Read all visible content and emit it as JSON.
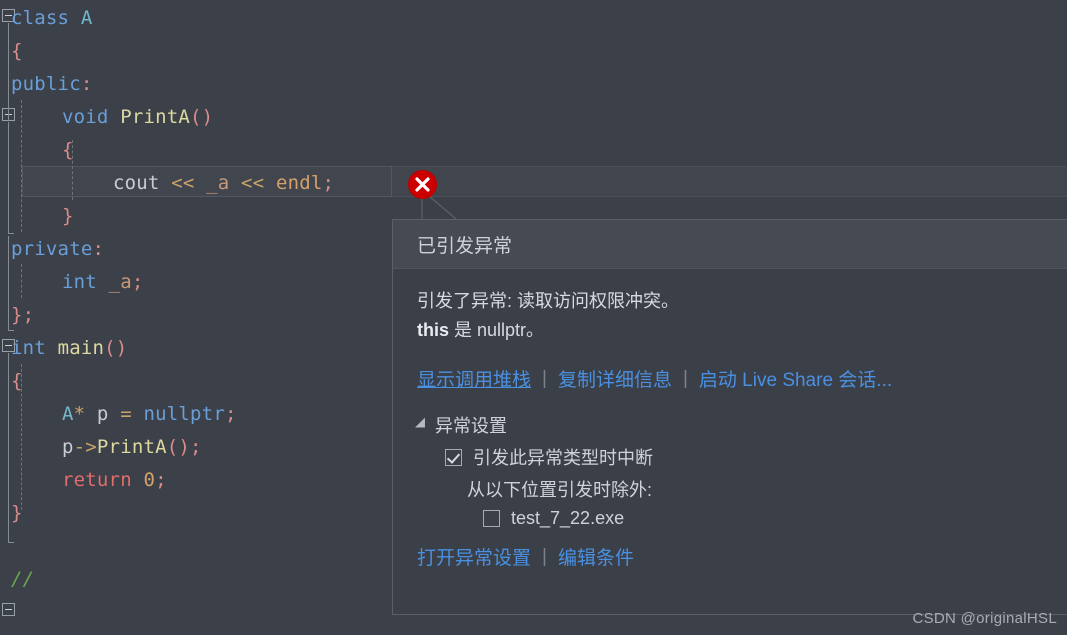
{
  "editor": {
    "language": "cpp",
    "background": "#3c4049",
    "lines": [
      {
        "indent": 0,
        "tokens": [
          {
            "t": "class",
            "c": "t-key"
          },
          {
            "t": " ",
            "c": "t-plain"
          },
          {
            "t": "A",
            "c": "t-type"
          }
        ]
      },
      {
        "indent": 0,
        "tokens": [
          {
            "t": "{",
            "c": "t-brace"
          }
        ]
      },
      {
        "indent": 0,
        "tokens": [
          {
            "t": "public",
            "c": "t-key"
          },
          {
            "t": ":",
            "c": "t-brace"
          }
        ]
      },
      {
        "indent": 1,
        "tokens": [
          {
            "t": "void",
            "c": "t-key"
          },
          {
            "t": " ",
            "c": "t-plain"
          },
          {
            "t": "PrintA",
            "c": "t-fn"
          },
          {
            "t": "()",
            "c": "t-brace"
          }
        ]
      },
      {
        "indent": 1,
        "tokens": [
          {
            "t": "{",
            "c": "t-brace"
          }
        ]
      },
      {
        "indent": 2,
        "tokens": [
          {
            "t": "cout",
            "c": "t-plain"
          },
          {
            "t": " ",
            "c": "t-plain"
          },
          {
            "t": "<<",
            "c": "t-op"
          },
          {
            "t": " ",
            "c": "t-plain"
          },
          {
            "t": "_a",
            "c": "t-var"
          },
          {
            "t": " ",
            "c": "t-plain"
          },
          {
            "t": "<<",
            "c": "t-op"
          },
          {
            "t": " ",
            "c": "t-plain"
          },
          {
            "t": "endl",
            "c": "t-mac"
          },
          {
            "t": ";",
            "c": "t-brace"
          }
        ]
      },
      {
        "indent": 1,
        "tokens": [
          {
            "t": "}",
            "c": "t-brace"
          }
        ]
      },
      {
        "indent": 0,
        "tokens": [
          {
            "t": "private",
            "c": "t-key"
          },
          {
            "t": ":",
            "c": "t-brace"
          }
        ]
      },
      {
        "indent": 1,
        "tokens": [
          {
            "t": "int",
            "c": "t-key"
          },
          {
            "t": " ",
            "c": "t-plain"
          },
          {
            "t": "_a",
            "c": "t-var"
          },
          {
            "t": ";",
            "c": "t-brace"
          }
        ]
      },
      {
        "indent": 0,
        "tokens": [
          {
            "t": "};",
            "c": "t-brace"
          }
        ]
      },
      {
        "indent": 0,
        "tokens": [
          {
            "t": "int",
            "c": "t-key"
          },
          {
            "t": " ",
            "c": "t-plain"
          },
          {
            "t": "main",
            "c": "t-fn"
          },
          {
            "t": "()",
            "c": "t-brace"
          }
        ]
      },
      {
        "indent": 0,
        "tokens": [
          {
            "t": "{",
            "c": "t-brace"
          }
        ]
      },
      {
        "indent": 1,
        "tokens": [
          {
            "t": "A",
            "c": "t-type"
          },
          {
            "t": "*",
            "c": "t-op"
          },
          {
            "t": " ",
            "c": "t-plain"
          },
          {
            "t": "p",
            "c": "t-plain"
          },
          {
            "t": " ",
            "c": "t-plain"
          },
          {
            "t": "=",
            "c": "t-op"
          },
          {
            "t": " ",
            "c": "t-plain"
          },
          {
            "t": "nullptr",
            "c": "t-null"
          },
          {
            "t": ";",
            "c": "t-brace"
          }
        ]
      },
      {
        "indent": 1,
        "tokens": [
          {
            "t": "p",
            "c": "t-plain"
          },
          {
            "t": "->",
            "c": "t-op"
          },
          {
            "t": "PrintA",
            "c": "t-fn"
          },
          {
            "t": "()",
            "c": "t-brace"
          },
          {
            "t": ";",
            "c": "t-brace"
          }
        ]
      },
      {
        "indent": 1,
        "tokens": [
          {
            "t": "return",
            "c": "t-ctl"
          },
          {
            "t": " ",
            "c": "t-plain"
          },
          {
            "t": "0",
            "c": "t-num"
          },
          {
            "t": ";",
            "c": "t-brace"
          }
        ]
      },
      {
        "indent": 0,
        "tokens": [
          {
            "t": "}",
            "c": "t-brace"
          }
        ]
      },
      {
        "indent": 0,
        "tokens": []
      },
      {
        "indent": 0,
        "tokens": [
          {
            "t": "//",
            "c": "t-cmt"
          }
        ]
      }
    ],
    "current_line_index": 5
  },
  "error_marker": {
    "icon": "error-circle-x-icon",
    "color": "#cc0000"
  },
  "popup": {
    "title": "已引发异常",
    "message_line1": "引发了异常: 读取访问权限冲突。",
    "message_line2_bold": "this",
    "message_line2_rest": " 是 nullptr。",
    "links": [
      {
        "label": "显示调用堆栈",
        "underlined": true
      },
      {
        "label": "复制详细信息",
        "underlined": false
      },
      {
        "label": "启动 Live Share 会话...",
        "underlined": false
      }
    ],
    "separator": "|",
    "settings": {
      "header": "异常设置",
      "break_checkbox": {
        "label": "引发此异常类型时中断",
        "checked": true
      },
      "except_when_label": "从以下位置引发时除外:",
      "module_checkbox": {
        "label": "test_7_22.exe",
        "checked": false
      },
      "links": [
        {
          "label": "打开异常设置"
        },
        {
          "label": "编辑条件"
        }
      ]
    }
  },
  "watermark": "CSDN @originalHSL",
  "colors": {
    "editor_bg": "#3c4049",
    "popup_bg": "#3b3f47",
    "popup_title_bg": "#454a53",
    "link": "#4a90e2",
    "error_red": "#cc0000",
    "text": "#d4d8de"
  }
}
